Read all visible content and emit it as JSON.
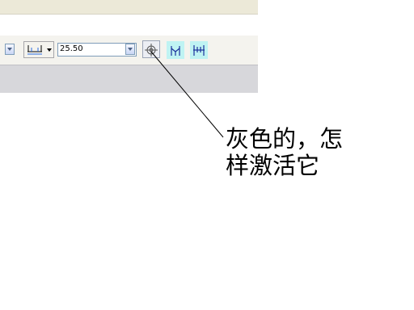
{
  "toolbar": {
    "size_value": "25.50"
  },
  "icons": {
    "left_dropdown": "chevron-down-icon",
    "dimension_style": "dimension-style-icon",
    "size_dropdown": "chevron-down-icon",
    "snap_target": "crosshair-target-icon",
    "symmetric": "symmetric-dimension-icon",
    "parallel": "parallel-dimension-icon"
  },
  "colors": {
    "toolbar_bg": "#f4f3ee",
    "titlebar_bg": "#ece9d8",
    "workspace_bg": "#d7d7db",
    "icon_highlight": "#bff3f3"
  },
  "annotation": {
    "text": "灰色的，怎\n样激活它"
  }
}
